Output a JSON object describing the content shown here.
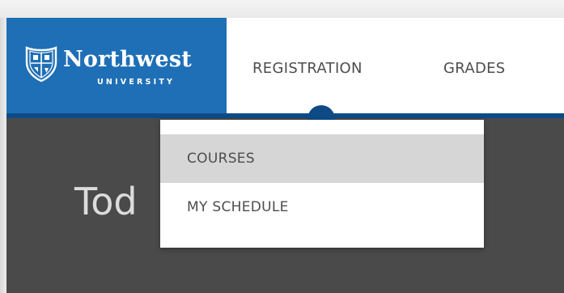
{
  "brand": {
    "name": "Northwest",
    "subname": "UNIVERSITY",
    "color": "#1f6fb6",
    "crest_icon": "shield-crest-icon"
  },
  "nav": {
    "items": [
      {
        "label": "REGISTRATION"
      },
      {
        "label": "GRADES"
      }
    ],
    "active_indicator_color": "#0e4b86"
  },
  "dropdown": {
    "items": [
      {
        "label": "COURSES",
        "highlighted": true
      },
      {
        "label": "MY SCHEDULE",
        "highlighted": false
      }
    ]
  },
  "page": {
    "title_partial": "Tod"
  },
  "colors": {
    "content_bg": "#4a4a4a",
    "nav_text": "#4d4d4d",
    "highlight_bg": "#d6d6d6"
  }
}
